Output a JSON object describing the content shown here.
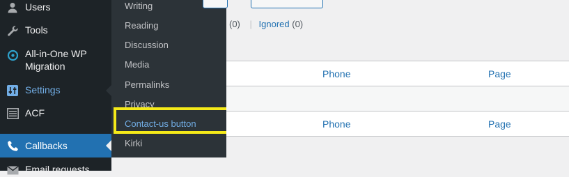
{
  "sidebar": {
    "items": [
      {
        "label": "Users",
        "icon": "users-icon"
      },
      {
        "label": "Tools",
        "icon": "wrench-icon"
      },
      {
        "label": "All-in-One WP Migration",
        "icon": "migration-icon"
      },
      {
        "label": "Settings",
        "icon": "settings-icon"
      },
      {
        "label": "ACF",
        "icon": "acf-icon"
      },
      {
        "label": "Callbacks",
        "icon": "phone-icon"
      },
      {
        "label": "Email requests",
        "icon": "email-icon"
      }
    ]
  },
  "submenu": {
    "items": [
      {
        "label": "Writing"
      },
      {
        "label": "Reading"
      },
      {
        "label": "Discussion"
      },
      {
        "label": "Media"
      },
      {
        "label": "Permalinks"
      },
      {
        "label": "Privacy"
      },
      {
        "label": "Contact-us button"
      },
      {
        "label": "Kirki"
      }
    ]
  },
  "filters": {
    "count_prefix": "(0)",
    "separator": "|",
    "ignored_label": "Ignored",
    "ignored_count": "(0)"
  },
  "table": {
    "header": {
      "phone": "Phone",
      "page": "Page"
    },
    "footer": {
      "phone": "Phone",
      "page": "Page"
    }
  },
  "colors": {
    "sidebar_bg": "#1d2327",
    "submenu_bg": "#2c3338",
    "accent": "#2271b1",
    "link": "#72aee6",
    "highlight": "#f5ea19"
  }
}
